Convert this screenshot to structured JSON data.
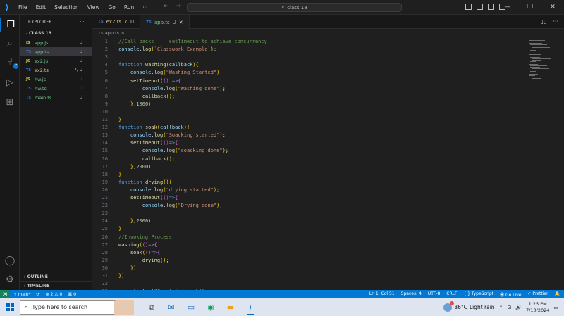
{
  "titlebar": {
    "menu": [
      "File",
      "Edit",
      "Selection",
      "View",
      "Go",
      "Run",
      "···"
    ],
    "search_text": "class 18",
    "controls": {
      "minimize": "—",
      "maximize": "❐",
      "close": "✕"
    }
  },
  "sidebar": {
    "header": "EXPLORER",
    "header_more": "···",
    "folder": "CLASS 18",
    "files": [
      {
        "ext": "JS",
        "name": "app.js",
        "status": "U",
        "selected": false
      },
      {
        "ext": "TS",
        "name": "app.ts",
        "status": "U",
        "selected": true
      },
      {
        "ext": "JS",
        "name": "ex2.js",
        "status": "U",
        "selected": false
      },
      {
        "ext": "TS",
        "name": "ex2.ts",
        "status": "7, U",
        "selected": false
      },
      {
        "ext": "JS",
        "name": "hw.js",
        "status": "U",
        "selected": false
      },
      {
        "ext": "TS",
        "name": "hw.ts",
        "status": "U",
        "selected": false
      },
      {
        "ext": "TS",
        "name": "main.ts",
        "status": "U",
        "selected": false
      }
    ],
    "outline": "OUTLINE",
    "timeline": "TIMELINE"
  },
  "tabs": [
    {
      "ext": "TS",
      "name": "ex2.ts",
      "status": "7, U",
      "active": false
    },
    {
      "ext": "TS",
      "name": "app.ts",
      "status": "U",
      "active": true,
      "close": "✕"
    }
  ],
  "breadcrumb": {
    "ext": "TS",
    "file": "app.ts",
    "rest": "> ..."
  },
  "editor": {
    "lines": [
      "//Call backs     setTimeout to achieve concurrency",
      "console.log(`Classwork Example`);",
      "",
      "function washing(callback){",
      "    console.log(\"Washing Started\")",
      "    setTimeout(() =>{",
      "        console.log(\"Washing done\");",
      "        callback();",
      "    },1000)",
      "",
      "}",
      "function soak(callback){",
      "    console.log(\"Soacking started\");",
      "    setTimeout(()=>{",
      "        console.log(\"soacking done\");",
      "        callback();",
      "    },2000)",
      "}",
      "function drying(){",
      "    console.log(\"drying started\");",
      "    setTimeout(()=>{",
      "        console.log(\"Drying done\");",
      "",
      "    },2000)",
      "}",
      "//Invoking Process",
      "washing(()=>{",
      "    soak(()=>{",
      "        drying();",
      "    })",
      "})",
      "",
      "console.log(\"Completed task\");"
    ]
  },
  "statusbar": {
    "remote": "⋊",
    "branch": "main*",
    "sync": "⟳",
    "problems": "⊗ 2 ⚠ 0",
    "ports": "⌘ 0",
    "position": "Ln 1, Col 51",
    "spaces": "Spaces: 4",
    "encoding": "UTF-8",
    "eol": "CRLF",
    "language": "{ } TypeScript",
    "golive": "Go Live",
    "prettier": "✓ Prettier",
    "bell": "🔔"
  },
  "taskbar": {
    "search_placeholder": "Type here to search",
    "weather_temp": "36°C",
    "weather_desc": "Light rain",
    "time": "1:25 PM",
    "date": "7/10/2024"
  },
  "colors": {
    "accent": "#0078d4",
    "untracked": "#73c991",
    "modified": "#e2c08d",
    "ts": "#3178c6",
    "js": "#cbcb41"
  }
}
